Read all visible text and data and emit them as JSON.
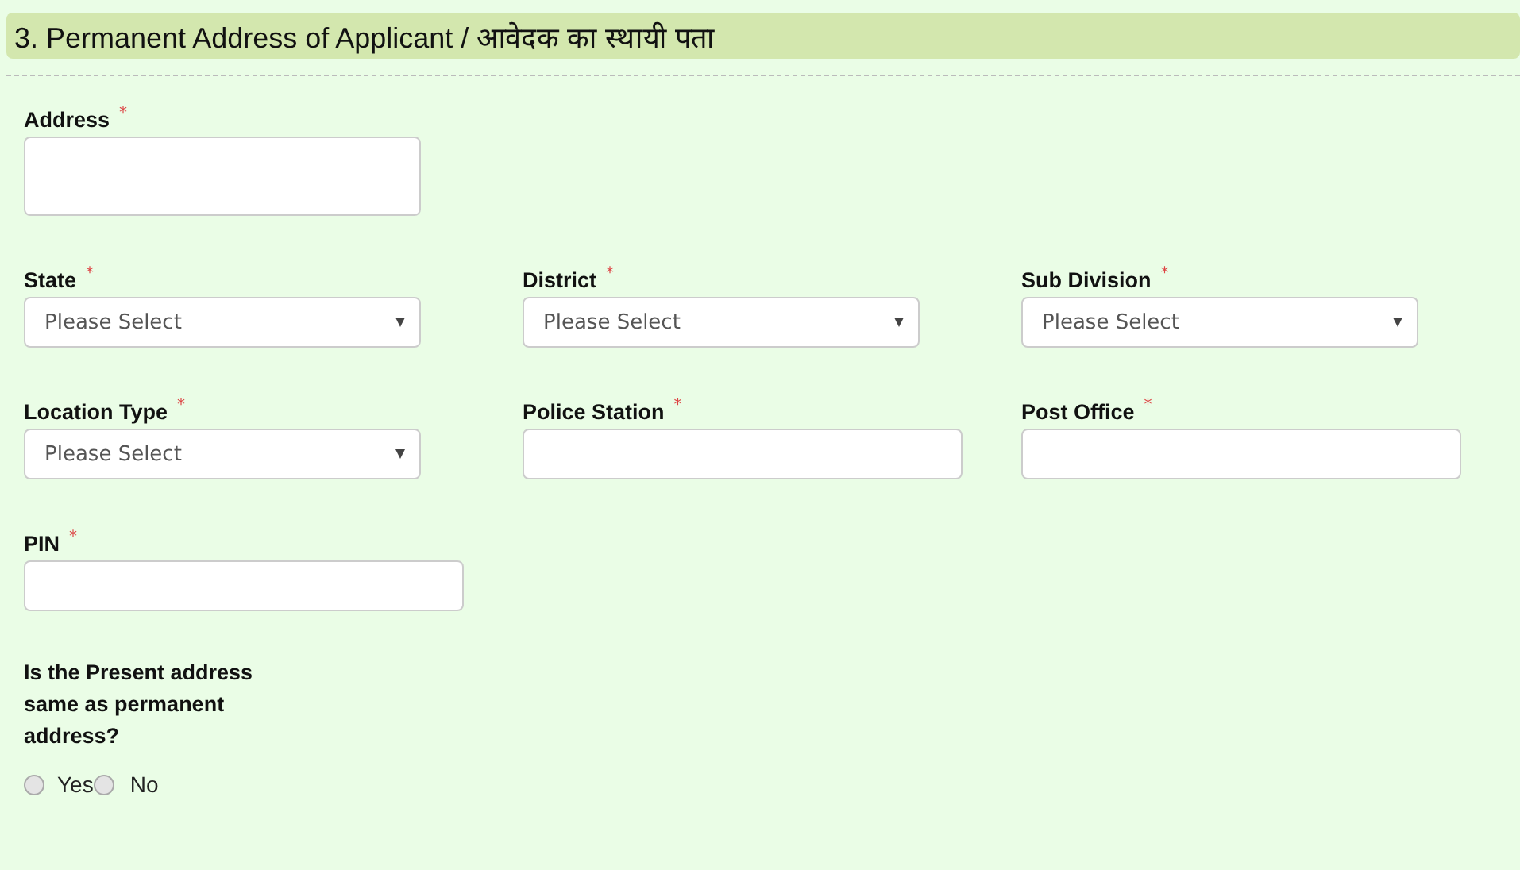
{
  "section": {
    "title": "3. Permanent Address of Applicant / आवेदक का स्थायी पता"
  },
  "rows": [
    [
      {
        "label": "Address",
        "required_mark": "*",
        "kind": "textarea"
      }
    ],
    [
      {
        "label": "State",
        "required_mark": "*",
        "kind": "select",
        "placeholder": "Please Select"
      },
      {
        "label": "District",
        "required_mark": "*",
        "kind": "select",
        "placeholder": "Please Select"
      },
      {
        "label": "Sub Division",
        "required_mark": "*",
        "kind": "select",
        "placeholder": "Please Select"
      }
    ],
    [
      {
        "label": "Location Type",
        "required_mark": "*",
        "kind": "select",
        "placeholder": "Please Select"
      },
      {
        "label": "Police Station",
        "required_mark": "*",
        "kind": "text"
      },
      {
        "label": "Post Office",
        "required_mark": "*",
        "kind": "text"
      }
    ],
    [
      {
        "label": "PIN",
        "required_mark": "*",
        "kind": "text"
      }
    ]
  ],
  "question": {
    "label": "Is the Present address same as permanent address?",
    "options": [
      {
        "label": "Yes",
        "selected": false
      },
      {
        "label": "No",
        "selected": false
      }
    ]
  }
}
